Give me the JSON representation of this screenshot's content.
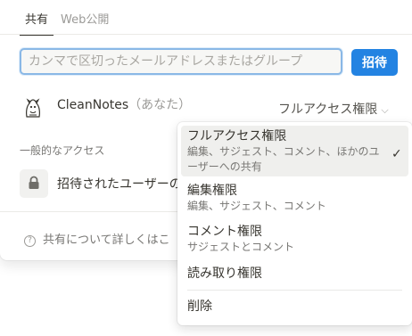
{
  "tabs": [
    {
      "label": "共有"
    },
    {
      "label": "Web公開"
    }
  ],
  "invite": {
    "placeholder": "カンマで区切ったメールアドレスまたはグループ",
    "button_label": "招待"
  },
  "user": {
    "name": "CleanNotes",
    "you_label": "（あなた）",
    "access_level": "フルアクセス権限"
  },
  "general_access": {
    "heading": "一般的なアクセス",
    "value": "招待されたユーザーの"
  },
  "help": {
    "text": "共有について詳しくはこ"
  },
  "menu": {
    "items": [
      {
        "title": "フルアクセス権限",
        "desc_line1": "編集、サジェスト、コメント、ほかのユ",
        "desc_line2": "ーザーへの共有",
        "selected": true
      },
      {
        "title": "編集権限",
        "desc_line1": "編集、サジェスト、コメント"
      },
      {
        "title": "コメント権限",
        "desc_line1": "サジェストとコメント"
      },
      {
        "title": "読み取り権限"
      }
    ],
    "remove_label": "削除",
    "check_glyph": "✓"
  },
  "colors": {
    "accent": "#2383e2",
    "focus_ring": "#8ab8e6",
    "menu_selected": "#efefed"
  }
}
